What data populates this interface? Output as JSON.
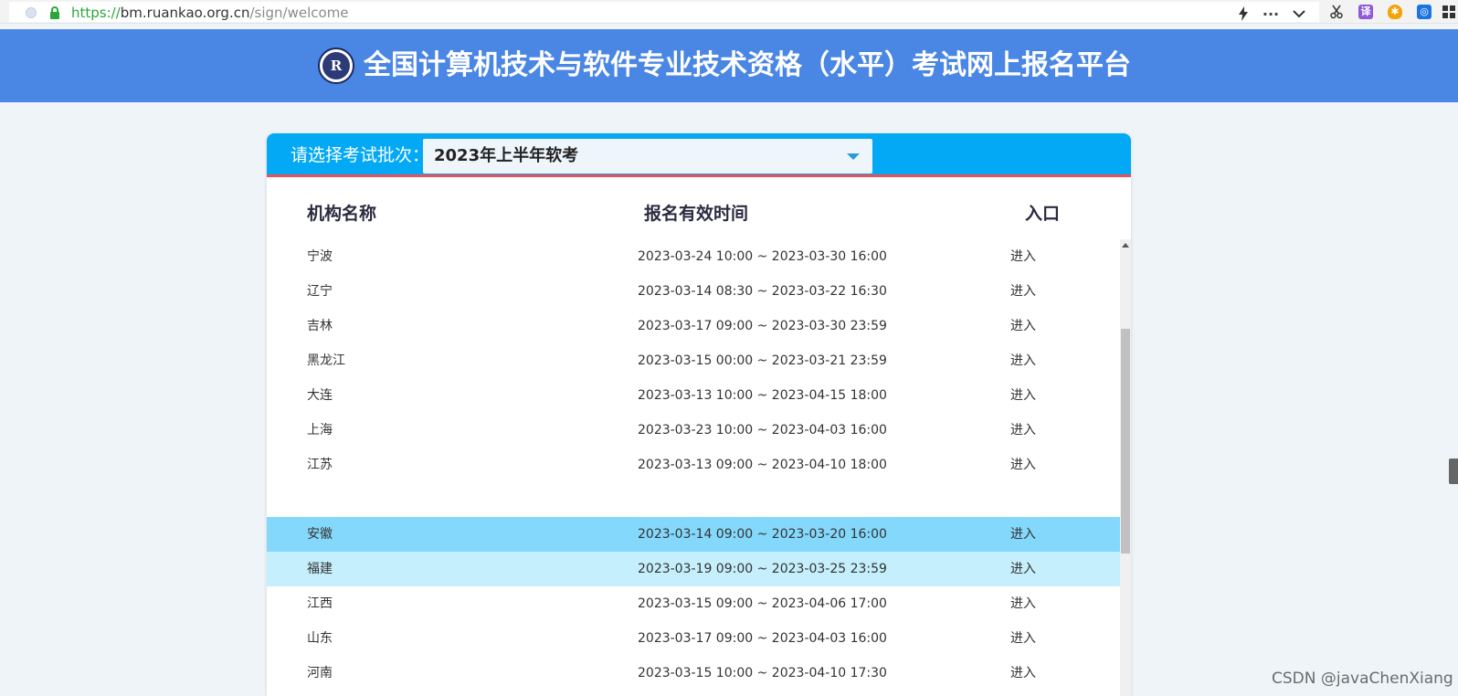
{
  "browser": {
    "url_scheme": "https://",
    "url_host": "bm.ruankao.org.cn",
    "url_path": "/sign/welcome",
    "ext_translate": "译",
    "ext_shield": "✱",
    "ext_blue": "◎"
  },
  "header": {
    "logo_text": "R",
    "title": "全国计算机技术与软件专业技术资格（水平）考试网上报名平台"
  },
  "batch": {
    "label": "请选择考试批次：",
    "selected": "2023年上半年软考"
  },
  "table": {
    "columns": {
      "name": "机构名称",
      "time": "报名有效时间",
      "entry": "入口"
    },
    "rows": [
      {
        "name": "宁波",
        "time": "2023-03-24 10:00 ~ 2023-03-30 16:00",
        "entry": "进入"
      },
      {
        "name": "辽宁",
        "time": "2023-03-14 08:30 ~ 2023-03-22 16:30",
        "entry": "进入"
      },
      {
        "name": "吉林",
        "time": "2023-03-17 09:00 ~ 2023-03-30 23:59",
        "entry": "进入"
      },
      {
        "name": "黑龙江",
        "time": "2023-03-15 00:00 ~ 2023-03-21 23:59",
        "entry": "进入"
      },
      {
        "name": "大连",
        "time": "2023-03-13 10:00 ~ 2023-04-15 18:00",
        "entry": "进入"
      },
      {
        "name": "上海",
        "time": "2023-03-23 10:00 ~ 2023-04-03 16:00",
        "entry": "进入"
      },
      {
        "name": "江苏",
        "time": "2023-03-13 09:00 ~ 2023-04-10 18:00",
        "entry": "进入"
      },
      {
        "name": "安徽",
        "time": "2023-03-14 09:00 ~ 2023-03-20 16:00",
        "entry": "进入"
      },
      {
        "name": "福建",
        "time": "2023-03-19 09:00 ~ 2023-03-25 23:59",
        "entry": "进入"
      },
      {
        "name": "江西",
        "time": "2023-03-15 09:00 ~ 2023-04-06 17:00",
        "entry": "进入"
      },
      {
        "name": "山东",
        "time": "2023-03-17 09:00 ~ 2023-04-03 16:00",
        "entry": "进入"
      },
      {
        "name": "河南",
        "time": "2023-03-15 10:00 ~ 2023-04-10 17:30",
        "entry": "进入"
      }
    ]
  },
  "watermark": "CSDN @javaChenXiang",
  "colors": {
    "header_bg": "#4a86e4",
    "card_head_bg": "#03a9f4",
    "accent_line": "#e8505b",
    "row_highlight_strong": "#84d8fb",
    "row_highlight_light": "#c5effc"
  }
}
